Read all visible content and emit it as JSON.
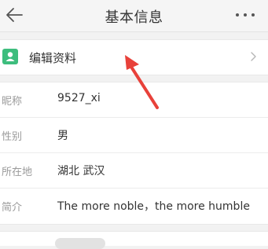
{
  "header": {
    "title": "基本信息",
    "back_icon": "back-arrow-icon",
    "more_icon": "more-dots-icon"
  },
  "edit_profile": {
    "label": "编辑资料",
    "icon": "edit-profile-icon",
    "icon_color": "#3dbd7d"
  },
  "profile_fields": [
    {
      "label": "昵称",
      "value": "9527_xi"
    },
    {
      "label": "性别",
      "value": "男"
    },
    {
      "label": "所在地",
      "value": "湖北 武汉"
    },
    {
      "label": "简介",
      "value": "The more noble，the more humble"
    }
  ],
  "annotation": {
    "arrow_color": "#e8413a"
  }
}
